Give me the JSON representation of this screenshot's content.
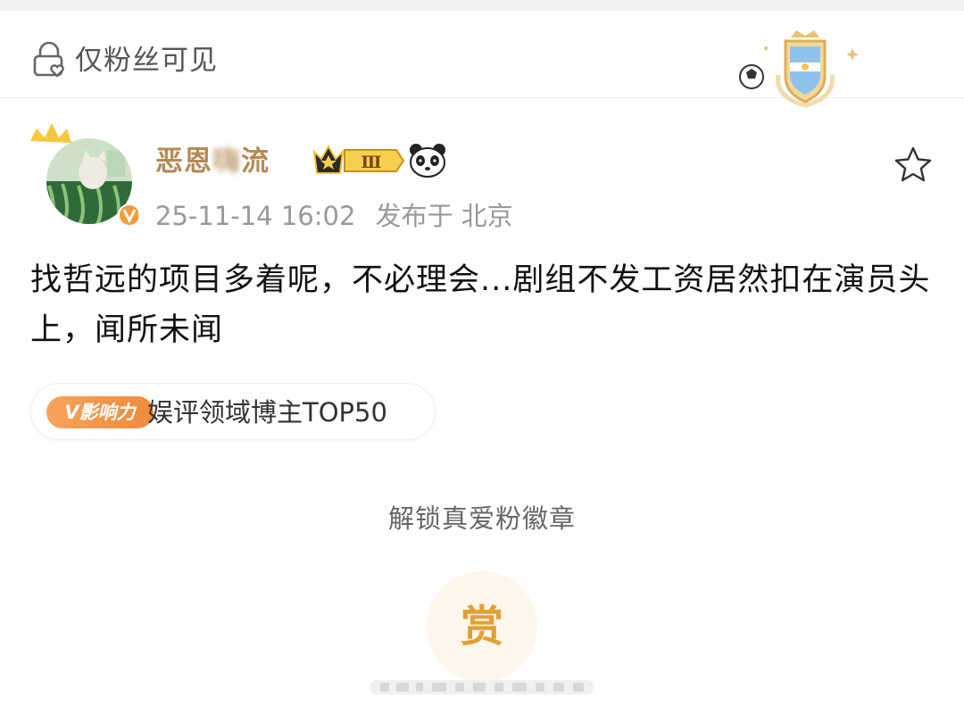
{
  "header": {
    "visibility_label": "仅粉丝可见"
  },
  "post": {
    "username_visible": "恶恩",
    "username_blurred": "嗨",
    "username_tail": "流",
    "vip_level": "Ⅲ",
    "timestamp": "25-11-14 16:02",
    "location": "发布于 北京",
    "content": "找哲远的项目多着呢，不必理会...剧组不发工资居然扣在演员头上，闻所未闻"
  },
  "influence": {
    "badge_label": "V影响力",
    "text": "娱评领域博主TOP50"
  },
  "reward": {
    "unlock_text": "解锁真爱粉徽章",
    "button_label": "赏"
  },
  "colors": {
    "username": "#b58a57",
    "accent_orange": "#f08a3c",
    "reward_gold": "#e2a033"
  },
  "icons": [
    "lock-heart-icon",
    "medal-icon",
    "crown-icon",
    "vip-badge-icon",
    "panda-icon",
    "star-icon",
    "verified-icon"
  ]
}
